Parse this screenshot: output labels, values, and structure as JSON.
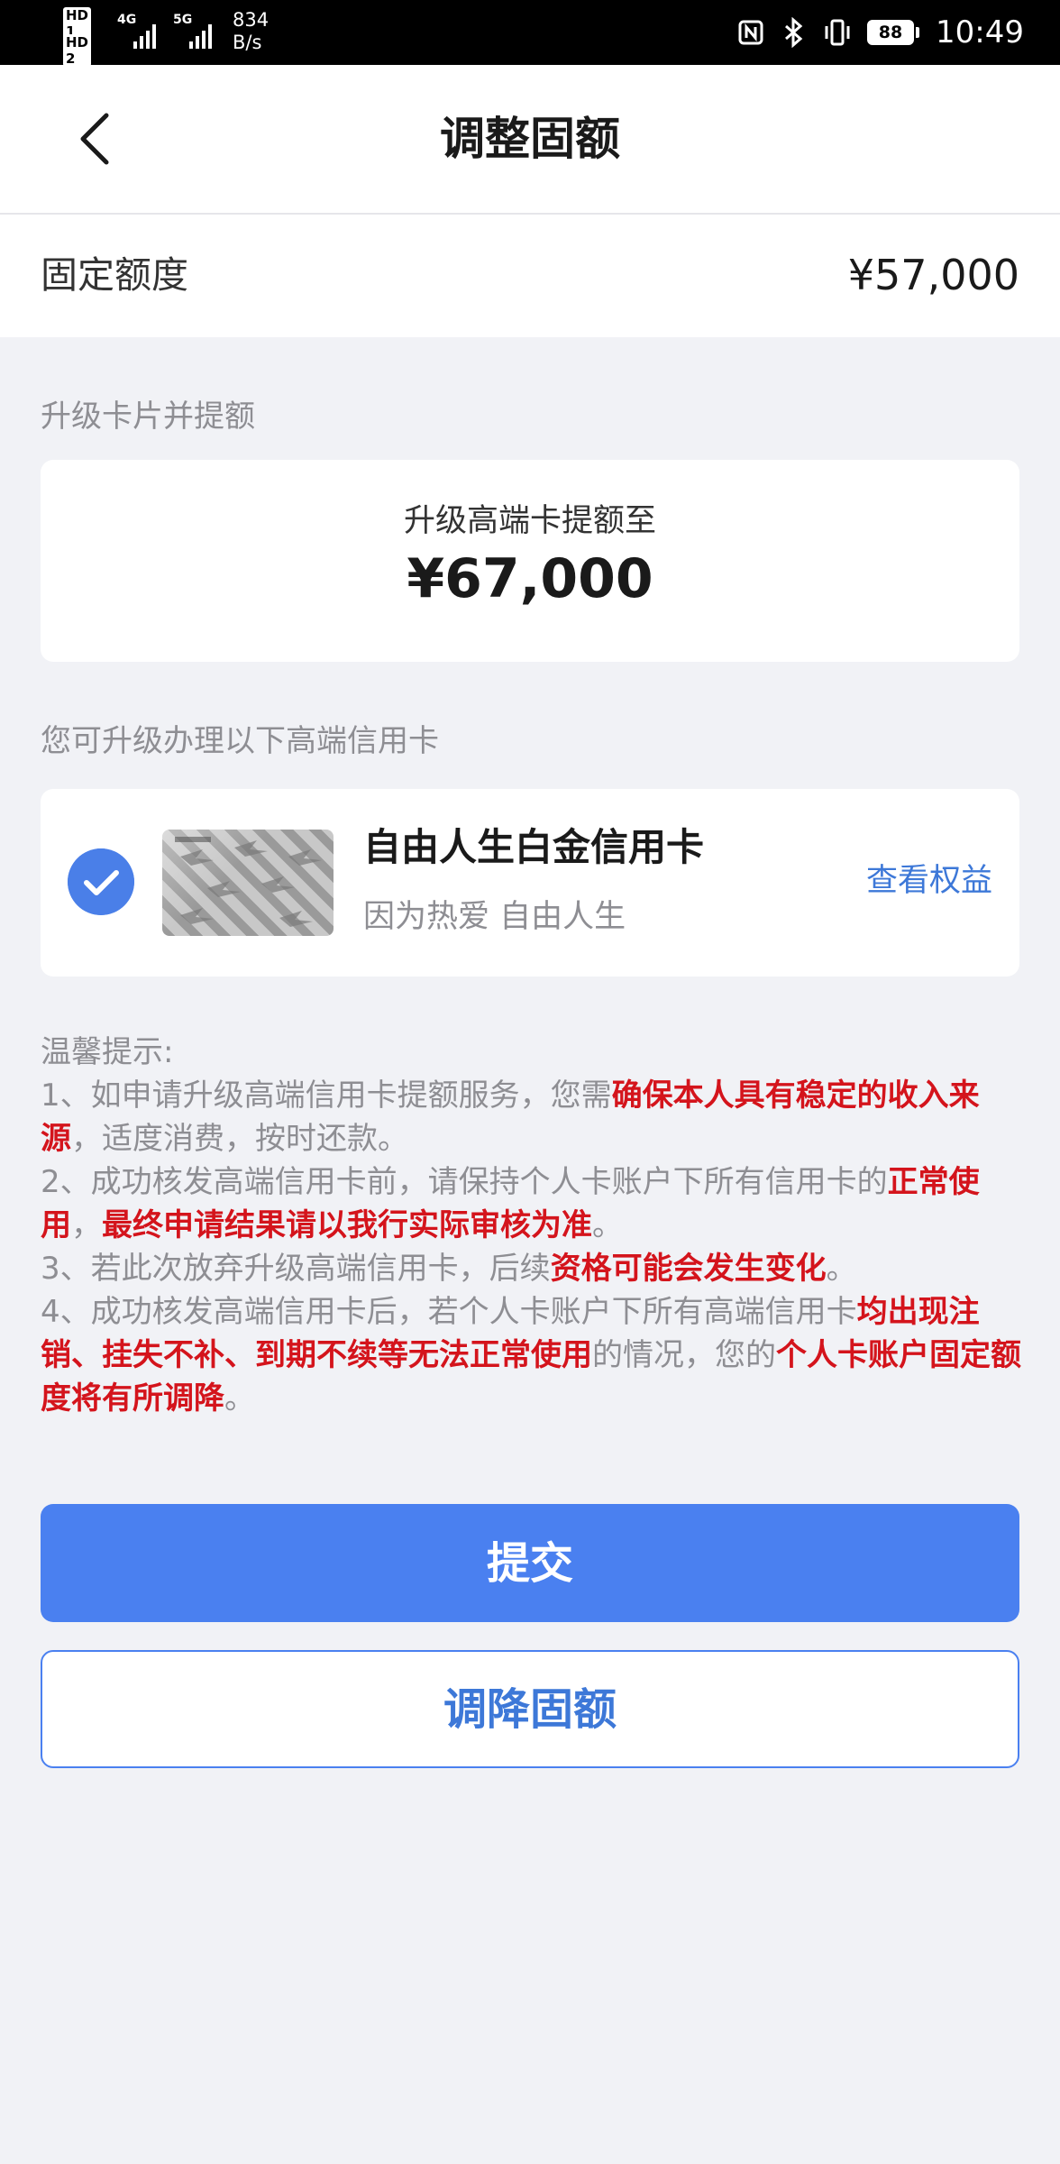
{
  "status_bar": {
    "hd1": "HD 1",
    "hd2": "HD 2",
    "net1": "4G",
    "net2": "5G",
    "speed_value": "834",
    "speed_unit": "B/s",
    "battery": "88",
    "time": "10:49"
  },
  "nav": {
    "title": "调整固额"
  },
  "fixed_limit": {
    "label": "固定额度",
    "value": "¥57,000"
  },
  "upgrade": {
    "section_title": "升级卡片并提额",
    "subtitle": "升级高端卡提额至",
    "amount": "¥67,000"
  },
  "card_list": {
    "section_title": "您可升级办理以下高端信用卡",
    "card": {
      "name": "自由人生白金信用卡",
      "slogan": "因为热爱 自由人生",
      "benefits_link": "查看权益"
    }
  },
  "tips": {
    "title": "温馨提示:",
    "t1a": "1、如申请升级高端信用卡提额服务，您需",
    "t1b": "确保本人具有稳定的收入来源",
    "t1c": "，适度消费，按时还款。",
    "t2a": "2、成功核发高端信用卡前，请保持个人卡账户下所有信用卡的",
    "t2b": "正常使用",
    "t2c": "，",
    "t2d": "最终申请结果请以我行实际审核为准",
    "t2e": "。",
    "t3a": "3、若此次放弃升级高端信用卡，后续",
    "t3b": "资格可能会发生变化",
    "t3c": "。",
    "t4a": "4、成功核发高端信用卡后，若个人卡账户下所有高端信用卡",
    "t4b": "均出现注销、挂失不补、到期不续等无法正常使用",
    "t4c": "的情况，您的",
    "t4d": "个人卡账户固定额度将有所调降",
    "t4e": "。"
  },
  "buttons": {
    "submit": "提交",
    "lower_limit": "调降固额"
  },
  "colors": {
    "primary": "#4a80f0",
    "link": "#3d78d8",
    "warning": "#d4141c",
    "background": "#f1f2f6"
  }
}
